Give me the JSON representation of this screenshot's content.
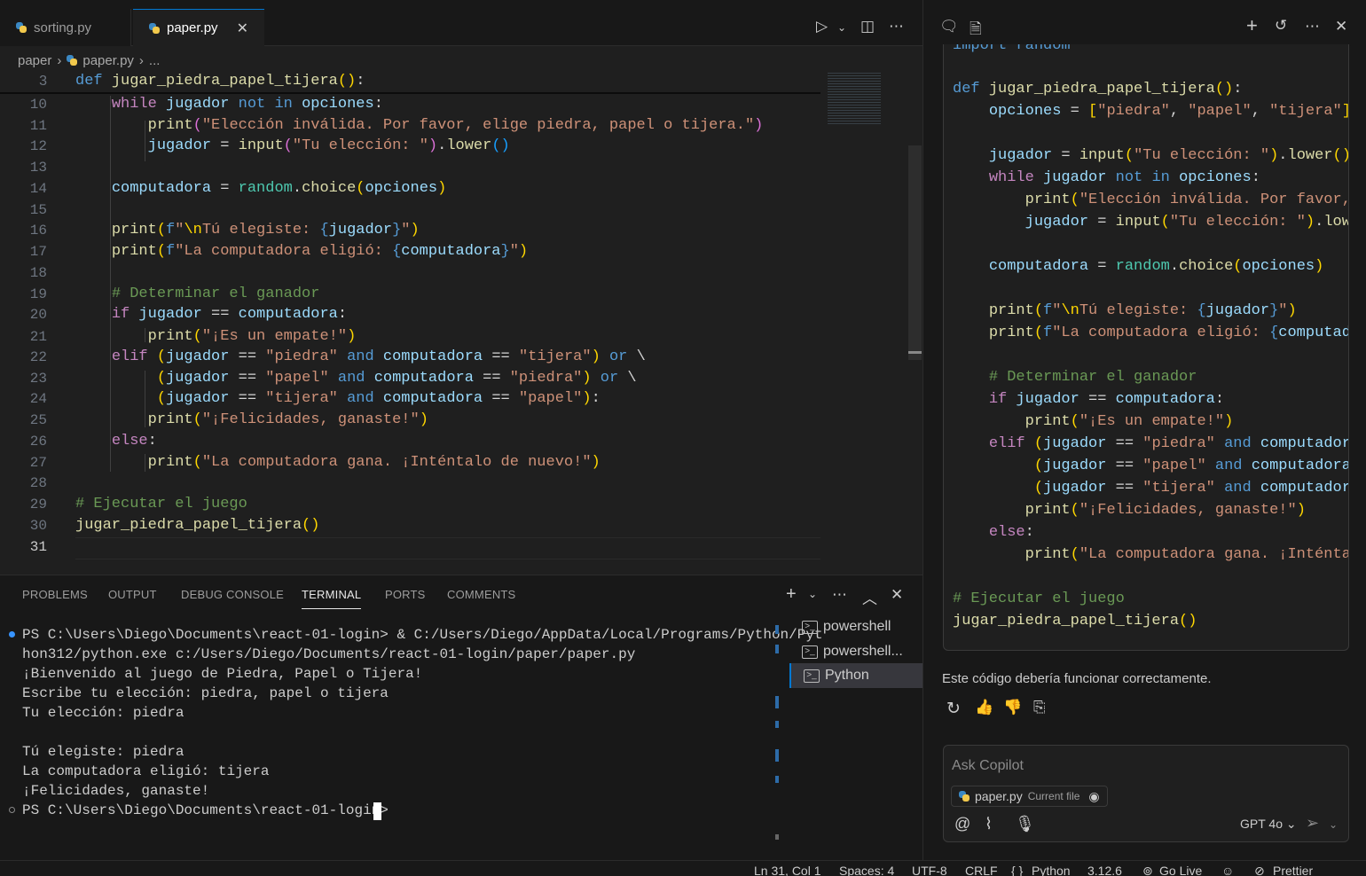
{
  "tabs": [
    {
      "label": "sorting.py"
    },
    {
      "label": "paper.py"
    }
  ],
  "breadcrumb": {
    "folder": "paper",
    "file": "paper.py",
    "more": "..."
  },
  "sticky": {
    "line": "3",
    "text": "def jugar_piedra_papel_tijera():"
  },
  "editor": {
    "line_numbers": [
      "10",
      "11",
      "12",
      "13",
      "14",
      "15",
      "16",
      "17",
      "18",
      "19",
      "20",
      "21",
      "22",
      "23",
      "24",
      "25",
      "26",
      "27",
      "28",
      "29",
      "30",
      "31"
    ]
  },
  "panel": {
    "tabs": [
      "PROBLEMS",
      "OUTPUT",
      "DEBUG CONSOLE",
      "TERMINAL",
      "PORTS",
      "COMMENTS"
    ],
    "active": "TERMINAL"
  },
  "terminal": {
    "lines": [
      "PS C:\\Users\\Diego\\Documents\\react-01-login> & C:/Users/Diego/AppData/Local/Programs/Python/Pyt",
      "hon312/python.exe c:/Users/Diego/Documents/react-01-login/paper/paper.py",
      "¡Bienvenido al juego de Piedra, Papel o Tijera!",
      "Escribe tu elección: piedra, papel o tijera",
      "Tu elección: piedra",
      "",
      "Tú elegiste: piedra",
      "La computadora eligió: tijera",
      "¡Felicidades, ganaste!",
      "PS C:\\Users\\Diego\\Documents\\react-01-login> "
    ],
    "instances": [
      "powershell",
      "powershell...",
      "Python"
    ]
  },
  "chat": {
    "truncated_top": "import random",
    "response_text": "Este código debería funcionar correctamente.",
    "ask_placeholder": "Ask Copilot",
    "context_file": "paper.py",
    "context_label": "Current file",
    "model": "GPT 4o"
  },
  "status": {
    "position": "Ln 31, Col 1",
    "spaces": "Spaces: 4",
    "encoding": "UTF-8",
    "eol": "CRLF",
    "language": "Python",
    "version": "3.12.6",
    "golive": "Go Live",
    "prettier": "Prettier"
  }
}
